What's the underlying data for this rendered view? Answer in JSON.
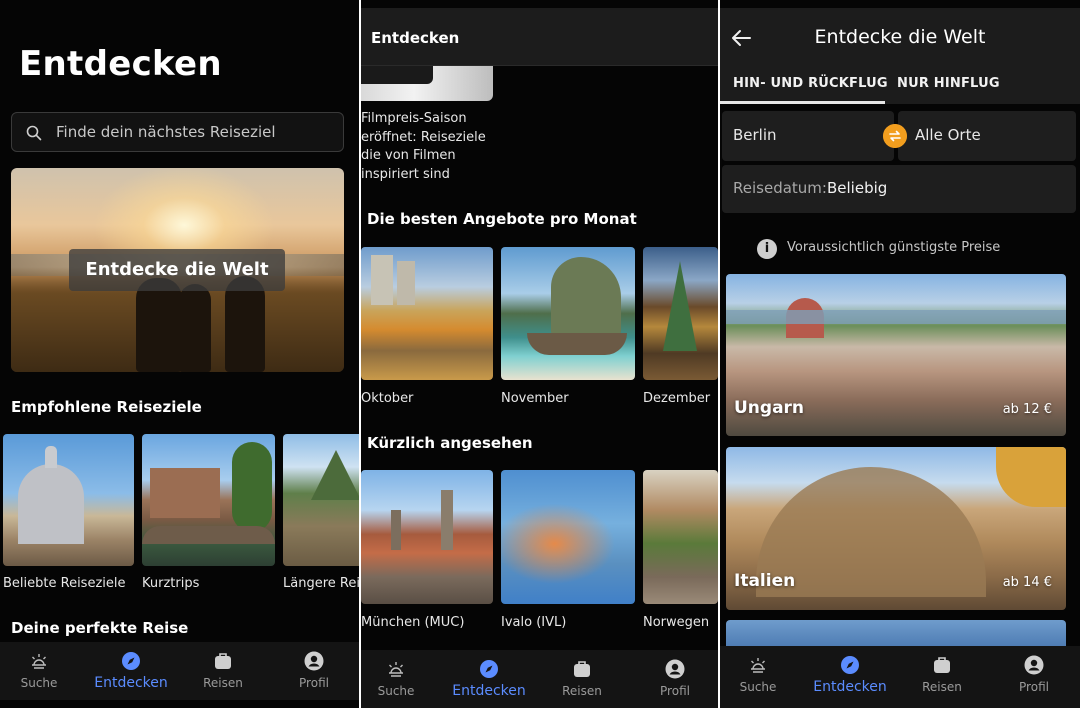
{
  "panel1": {
    "title": "Entdecken",
    "search": {
      "placeholder": "Finde dein nächstes Reiseziel",
      "icon": "search-icon"
    },
    "hero": {
      "label": "Entdecke die Welt"
    },
    "recommended": {
      "heading": "Empfohlene Reiseziele",
      "items": [
        {
          "label": "Beliebte Reiseziele"
        },
        {
          "label": "Kurztrips"
        },
        {
          "label": "Längere Rei"
        }
      ]
    },
    "perfect_trip": {
      "heading": "Deine perfekte Reise"
    }
  },
  "panel2": {
    "header_title": "Entdecken",
    "article": {
      "text": "Filmpreis-Saison eröffnet: Reiseziele die von Filmen inspiriert sind"
    },
    "monthly": {
      "heading": "Die besten Angebote pro Monat",
      "items": [
        {
          "label": "Oktober"
        },
        {
          "label": "November"
        },
        {
          "label": "Dezember"
        }
      ]
    },
    "recent": {
      "heading": "Kürzlich angesehen",
      "items": [
        {
          "label": "München (MUC)"
        },
        {
          "label": "Ivalo (IVL)"
        },
        {
          "label": "Norwegen"
        }
      ]
    }
  },
  "panel3": {
    "title": "Entdecke die Welt",
    "tabs": [
      {
        "label": "HIN- UND RÜCKFLUG",
        "active": true
      },
      {
        "label": "NUR HINFLUG",
        "active": false
      }
    ],
    "origin": "Berlin",
    "destination": "Alle Orte",
    "date_label": "Reisedatum:",
    "date_value": "Beliebig",
    "info": "Voraussichtlich günstigste Preise",
    "destinations": [
      {
        "name": "Ungarn",
        "price": "ab 12 €"
      },
      {
        "name": "Italien",
        "price": "ab 14 €"
      }
    ]
  },
  "nav": {
    "items": [
      {
        "label": "Suche",
        "icon": "sunrise-icon"
      },
      {
        "label": "Entdecken",
        "icon": "compass-icon",
        "active": true
      },
      {
        "label": "Reisen",
        "icon": "suitcase-icon"
      },
      {
        "label": "Profil",
        "icon": "profile-icon"
      }
    ]
  },
  "colors": {
    "accent": "#5b8cff",
    "swap": "#f29e1e",
    "background": "#050505"
  }
}
